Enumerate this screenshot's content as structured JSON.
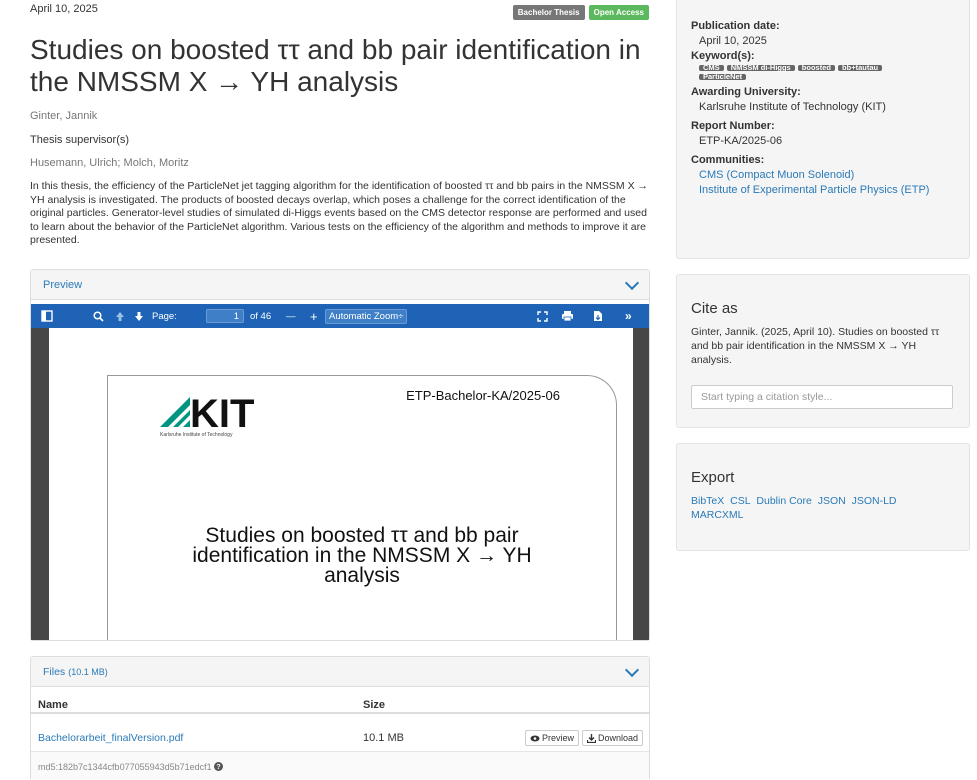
{
  "record": {
    "date": "April 10, 2025",
    "badges": [
      "Bachelor Thesis",
      "Open Access"
    ],
    "title": "Studies on boosted ττ and bb pair identification in the NMSSM X → YH analysis",
    "authors": "Ginter, Jannik",
    "supervisor_label": "Thesis supervisor(s)",
    "supervisors": "Husemann, Ulrich; Molch, Moritz",
    "abstract": "In this thesis, the efficiency of the ParticleNet jet tagging algorithm for the identification of boosted ττ and bb pairs in the NMSSM X → YH analysis is investigated. The products of boosted decays overlap, which poses a challenge for the correct identification of the original particles. Generator-level studies of simulated di-Higgs events based on the CMS detector response are performed and used to learn about the behavior of the ParticleNet algorithm. Various tests on the efficiency of the algorithm and methods to improve it are presented."
  },
  "preview": {
    "heading": "Preview",
    "toolbar": {
      "page_label": "Page:",
      "page_value": "1",
      "page_of": "of 46",
      "minus": "—",
      "plus": "+",
      "zoom": "Automatic Zoom",
      "zoom_arrow": "÷"
    },
    "doc": {
      "logo_text": "KIT",
      "logo_sub": "Karlsruhe Institute of Technology",
      "report": "ETP-Bachelor-KA/2025-06",
      "title_line1": "Studies on boosted ττ and bb pair",
      "title_line2": "identification in the NMSSM X → YH",
      "title_line3": "analysis"
    }
  },
  "files": {
    "heading": "Files",
    "total": "(10.1 MB)",
    "col_name": "Name",
    "col_size": "Size",
    "items": [
      {
        "name": "Bachelorarbeit_finalVersion.pdf",
        "size": "10.1 MB",
        "preview_label": "Preview",
        "download_label": "Download",
        "md5": "md5:182b7c1344cfb077055943d5b71edcf1"
      }
    ]
  },
  "sidebar": {
    "pub_date_label": "Publication date:",
    "pub_date": "April 10, 2025",
    "keywords_label": "Keyword(s):",
    "keywords": [
      "CMS",
      "NMSSM di-Higgs",
      "boosted",
      "bb+tautau",
      "ParticleNet"
    ],
    "university_label": "Awarding University:",
    "university": "Karlsruhe Institute of Technology (KIT)",
    "report_label": "Report Number:",
    "report": "ETP-KA/2025-06",
    "communities_label": "Communities:",
    "communities": [
      "CMS (Compact Muon Solenoid)",
      "Institute of Experimental Particle Physics (ETP)"
    ],
    "cite_heading": "Cite as",
    "cite_text": "Ginter, Jannik. (2025, April 10). Studies on boosted ττ and bb pair identification in the NMSSM X → YH analysis.",
    "cite_placeholder": "Start typing a citation style...",
    "export_heading": "Export",
    "export_formats": [
      "BibTeX",
      "CSL",
      "Dublin Core",
      "JSON",
      "JSON-LD",
      "MARCXML"
    ]
  },
  "colors": {
    "link": "#2a7ab8",
    "pdf_toolbar": "#1e63b5",
    "badge_gray": "#777777",
    "badge_green": "#5cb85c",
    "kit_green": "#009682"
  }
}
